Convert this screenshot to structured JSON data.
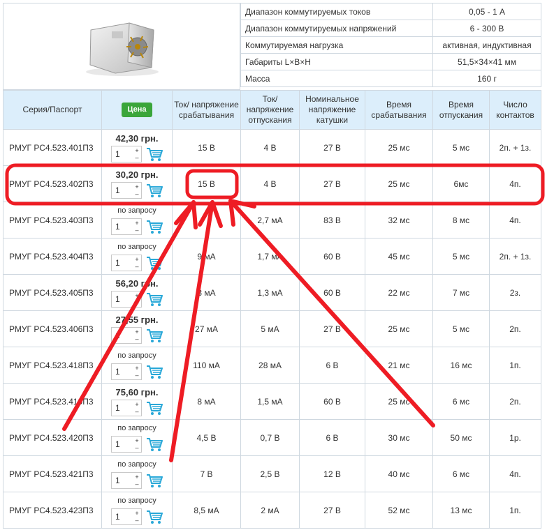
{
  "specs": [
    {
      "key": "Диапазон коммутируемых токов",
      "value": "0,05 - 1 А"
    },
    {
      "key": "Диапазон коммутируемых напряжений",
      "value": "6 - 300 В"
    },
    {
      "key": "Коммутируемая нагрузка",
      "value": "активная, индуктивная"
    },
    {
      "key": "Габариты L×B×H",
      "value": "51,5×34×41 мм"
    },
    {
      "key": "Масса",
      "value": "160 г"
    }
  ],
  "headers": {
    "series": "Серия/Паспорт",
    "price": "Цена",
    "pickup": "Ток/ напряжение срабатывания",
    "release": "Ток/ напряжение отпускания",
    "coil": "Номинальное напряжение катушки",
    "op_time": "Время срабатывания",
    "rel_time": "Время отпускания",
    "contacts": "Число контактов"
  },
  "rows": [
    {
      "name": "РМУГ РС4.523.401П3",
      "price": "42,30 грн.",
      "qty": "1",
      "pickup": "15 В",
      "release": "4 В",
      "coil": "27 В",
      "op_time": "25 мс",
      "rel_time": "5 мс",
      "contacts": "2п. + 1з."
    },
    {
      "name": "РМУГ РС4.523.402П3",
      "price": "30,20 грн.",
      "qty": "1",
      "pickup": "15 В",
      "release": "4 В",
      "coil": "27 В",
      "op_time": "25 мс",
      "rel_time": "6мс",
      "contacts": "4п."
    },
    {
      "name": "РМУГ РС4.523.403П3",
      "price": "по запросу",
      "qty": "1",
      "pickup": "",
      "release": "2,7 мА",
      "coil": "83 В",
      "op_time": "32 мс",
      "rel_time": "8 мс",
      "contacts": "4п."
    },
    {
      "name": "РМУГ РС4.523.404П3",
      "price": "по запросу",
      "qty": "1",
      "pickup": "9 мА",
      "release": "1,7 мА",
      "coil": "60 В",
      "op_time": "45 мс",
      "rel_time": "5 мс",
      "contacts": "2п. + 1з."
    },
    {
      "name": "РМУГ РС4.523.405П3",
      "price": "56,20 грн.",
      "qty": "1",
      "pickup": "3 мА",
      "release": "1,3 мА",
      "coil": "60 В",
      "op_time": "22 мс",
      "rel_time": "7 мс",
      "contacts": "2з."
    },
    {
      "name": "РМУГ РС4.523.406П3",
      "price": "27,55 грн.",
      "qty": "1",
      "pickup": "27 мА",
      "release": "5 мА",
      "coil": "27 В",
      "op_time": "25 мс",
      "rel_time": "5 мс",
      "contacts": "2п."
    },
    {
      "name": "РМУГ РС4.523.418П3",
      "price": "по запросу",
      "qty": "1",
      "pickup": "110 мА",
      "release": "28 мА",
      "coil": "6 В",
      "op_time": "21 мс",
      "rel_time": "16 мс",
      "contacts": "1п."
    },
    {
      "name": "РМУГ РС4.523.419П3",
      "price": "75,60 грн.",
      "qty": "1",
      "pickup": "8 мА",
      "release": "1,5 мА",
      "coil": "60 В",
      "op_time": "25 мс",
      "rel_time": "6 мс",
      "contacts": "2п."
    },
    {
      "name": "РМУГ РС4.523.420П3",
      "price": "по запросу",
      "qty": "1",
      "pickup": "4,5 В",
      "release": "0,7 В",
      "coil": "6 В",
      "op_time": "30 мс",
      "rel_time": "50 мс",
      "contacts": "1р."
    },
    {
      "name": "РМУГ РС4.523.421П3",
      "price": "по запросу",
      "qty": "1",
      "pickup": "7 В",
      "release": "2,5 В",
      "coil": "12 В",
      "op_time": "40 мс",
      "rel_time": "6 мс",
      "contacts": "4п."
    },
    {
      "name": "РМУГ РС4.523.423П3",
      "price": "по запросу",
      "qty": "1",
      "pickup": "8,5 мА",
      "release": "2 мА",
      "coil": "27 В",
      "op_time": "52 мс",
      "rel_time": "13 мс",
      "contacts": "1п."
    }
  ],
  "stepper": {
    "plus": "+",
    "minus": "–"
  },
  "colors": {
    "header_bg": "#dceefb",
    "price_badge": "#3aa53a",
    "annotation": "#ee1c24",
    "cart": "#29a8d8"
  }
}
